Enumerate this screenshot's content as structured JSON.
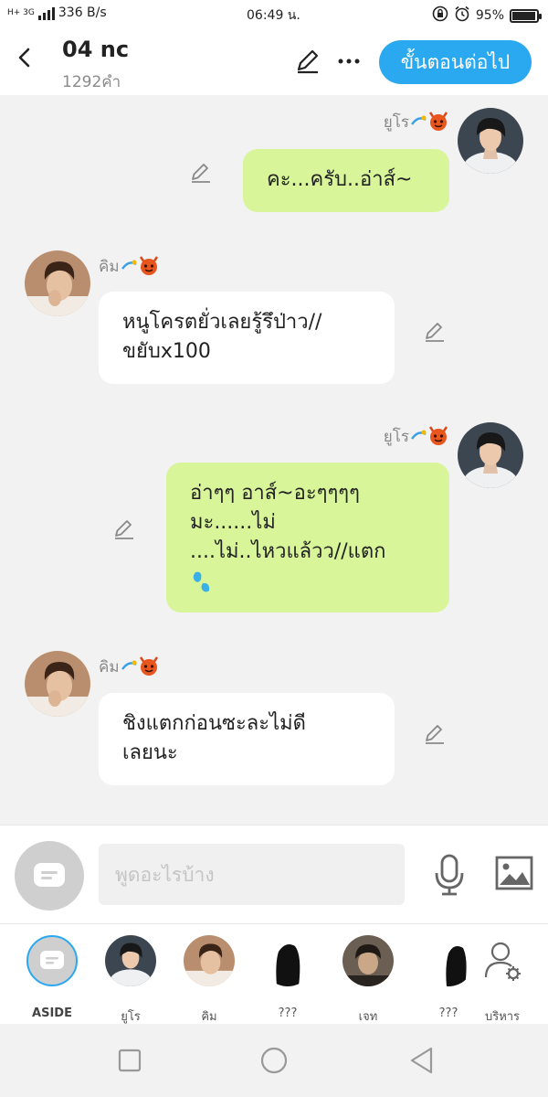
{
  "status_bar": {
    "network": "H+ 3G",
    "speed": "336 B/s",
    "time": "06:49 น.",
    "battery": "95%",
    "battery_level": 0.95
  },
  "header": {
    "title": "04 nc",
    "word_count": "1292คำ",
    "next_button": "ขั้นตอนต่อไป"
  },
  "messages": [
    {
      "side": "right",
      "sender": "ยูโร",
      "text": "คะ...ครับ..อ่าส์~"
    },
    {
      "side": "left",
      "sender": "คิม",
      "text": "หนูโครตยั่วเลยรู้รึป่าว//\nขยับx100"
    },
    {
      "side": "right",
      "sender": "ยูโร",
      "text": "อ่าๆๆ อาส์~อะๆๆๆๆ\nมะ......ไม่\n....ไม่..ไหวแล้วว//แตก"
    },
    {
      "side": "left",
      "sender": "คิม",
      "text": "ชิงแตกก่อนซะละไม่ดี\nเลยนะ"
    }
  ],
  "input": {
    "placeholder": "พูดอะไรบ้าง"
  },
  "characters": [
    {
      "label": "ASIDE"
    },
    {
      "label": "ยูโร"
    },
    {
      "label": "คิม"
    },
    {
      "label": "???"
    },
    {
      "label": "เจท"
    },
    {
      "label": "???"
    },
    {
      "label": "บริหาร"
    }
  ],
  "colors": {
    "accent": "#2aa9f0",
    "bubble_right": "#d8f59a",
    "bubble_left": "#ffffff",
    "background": "#f2f2f2"
  }
}
